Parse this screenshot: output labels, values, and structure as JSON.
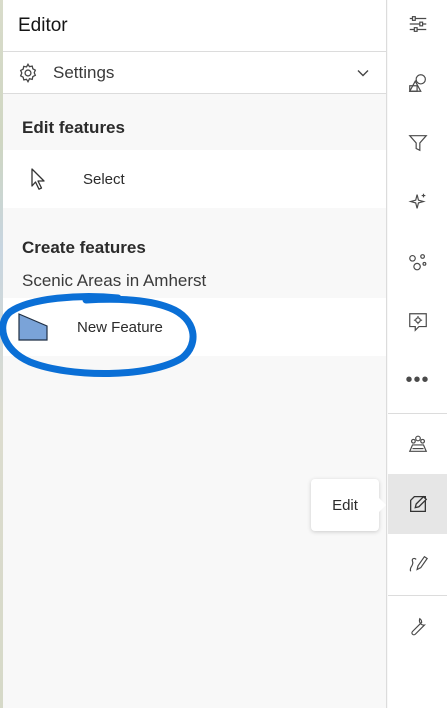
{
  "editor": {
    "title": "Editor",
    "settings_label": "Settings",
    "edit_features_heading": "Edit features",
    "select_label": "Select",
    "create_features_heading": "Create features",
    "layer_name": "Scenic Areas in Amherst",
    "new_feature_label": "New Feature"
  },
  "tooltip": {
    "text": "Edit"
  },
  "actionbar": {
    "items": [
      {
        "icon": "sliders-icon"
      },
      {
        "icon": "basemap-icon"
      },
      {
        "icon": "filter-icon"
      },
      {
        "icon": "sparkle-icon"
      },
      {
        "icon": "analysis-icon"
      },
      {
        "icon": "gear-chat-icon"
      },
      {
        "icon": "more-icon",
        "text": "•••"
      },
      {
        "icon": "map-layers-icon"
      },
      {
        "icon": "edit-icon"
      },
      {
        "icon": "sketch-icon"
      },
      {
        "icon": "wrench-icon"
      }
    ]
  },
  "colors": {
    "annotation_blue": "#0a6fd6",
    "polygon_fill": "#7aa3d8",
    "active_bg": "#e6e6e6"
  }
}
